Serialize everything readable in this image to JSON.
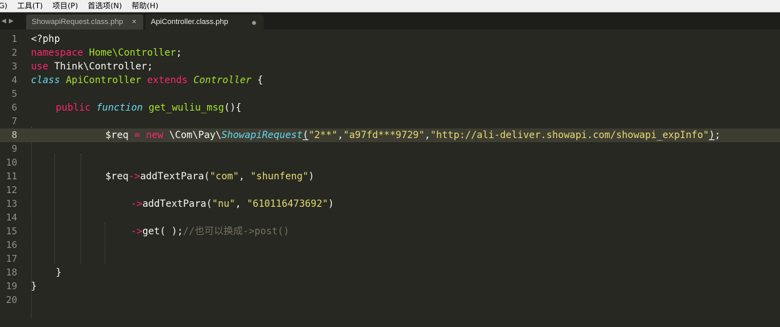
{
  "menubar": {
    "items": [
      "G)",
      "工具(T)",
      "项目(P)",
      "首选项(N)",
      "帮助(H)"
    ]
  },
  "tabs": [
    {
      "label": "ShowapiRequest.class.php",
      "control": "×"
    },
    {
      "label": "ApiController.class.php",
      "control": "●"
    }
  ],
  "editor": {
    "line_numbers": [
      "1",
      "2",
      "3",
      "4",
      "5",
      "6",
      "7",
      "8",
      "9",
      "10",
      "11",
      "12",
      "13",
      "14",
      "15",
      "16",
      "17",
      "18",
      "19",
      "20"
    ],
    "current_line": 8,
    "lines": {
      "l1": {
        "php_open": "<?php"
      },
      "l2": {
        "kw": "namespace",
        "name": " Home\\Controller",
        "end": ";"
      },
      "l3": {
        "kw": "use",
        "name": " Think\\Controller;"
      },
      "l4": {
        "kw1": "class",
        "cls": " ApiController",
        "kw2": " extends",
        "parent": " Controller",
        "brace": " {"
      },
      "l6": {
        "kw": "public",
        "fn_kw": " function",
        "fn": " get_wuliu_msg",
        "rest": "(){"
      },
      "l8": {
        "var": "$req",
        "eq": " = ",
        "new_kw": "new",
        "path": " \\Com\\Pay\\",
        "cls": "ShowapiRequest",
        "p_open": "(",
        "a1": "\"2**\"",
        "c1": ",",
        "a2": "\"a97fd***9729\"",
        "c2": ",",
        "a3": "\"http://ali-deliver.showapi.com/showapi_expInfo\"",
        "p_close": ")",
        "semi": ";"
      },
      "l11": {
        "var": "$req",
        "arrow": "->",
        "method": "addTextPara(",
        "a1": "\"com\"",
        "sep": ", ",
        "a2": "\"shunfeng\"",
        "close": ")"
      },
      "l13": {
        "arrow": "->",
        "method": "addTextPara(",
        "a1": "\"nu\"",
        "sep": ", ",
        "a2": "\"610116473692\"",
        "close": ")"
      },
      "l15": {
        "arrow": "->",
        "method": "get( );",
        "comment": "//也可以换成->post()"
      },
      "l18": {
        "brace": "}"
      },
      "l19": {
        "brace": "}"
      }
    }
  }
}
